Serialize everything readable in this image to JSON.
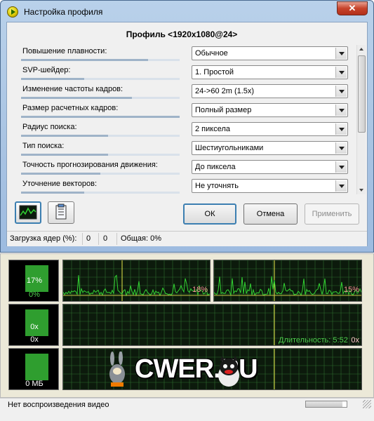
{
  "window": {
    "title": "Настройка профиля",
    "close_label": "✕"
  },
  "profile": {
    "title": "Профиль <1920x1080@24>"
  },
  "settings": [
    {
      "label": "Повышение плавности:",
      "value": "Обычное",
      "level": 0.8
    },
    {
      "label": "SVP-шейдер:",
      "value": "1. Простой",
      "level": 0.4
    },
    {
      "label": "Изменение частоты кадров:",
      "value": "24->60 2m (1.5x)",
      "level": 0.7
    },
    {
      "label": "Размер расчетных кадров:",
      "value": "Полный размер",
      "level": 1.0
    },
    {
      "label": "Радиус поиска:",
      "value": "2 пиксела",
      "level": 0.55
    },
    {
      "label": "Тип поиска:",
      "value": "Шестиугольниками",
      "level": 0.55
    },
    {
      "label": "Точность прогнозирования движения:",
      "value": "До пиксела",
      "level": 0.5
    },
    {
      "label": "Уточнение векторов:",
      "value": "Не уточнять",
      "level": 0.4
    }
  ],
  "buttons": {
    "ok": "ОК",
    "cancel": "Отмена",
    "apply": "Применить"
  },
  "status": {
    "cpu_label": "Загрузка ядер (%):",
    "core1": "0",
    "core2": "0",
    "total": "Общая: 0%"
  },
  "monitor": {
    "tile1": {
      "top": "17%",
      "bottom": "0%",
      "level": 0.17
    },
    "tile2": {
      "top": "0x",
      "bottom": "0x"
    },
    "tile3": {
      "bottom": "0 МБ"
    },
    "graph1_value": "18%",
    "graph2_value": "15%",
    "duration": "Длительность: 5:52",
    "duration_x": "0x",
    "watermark": "CWER.RU"
  },
  "footer": {
    "text": "Нет воспроизведения видео",
    "progress": 0.9
  },
  "colors": {
    "graph_line": "#32d232",
    "marker": "#e8e84a",
    "grid": "#2f6a2f"
  }
}
